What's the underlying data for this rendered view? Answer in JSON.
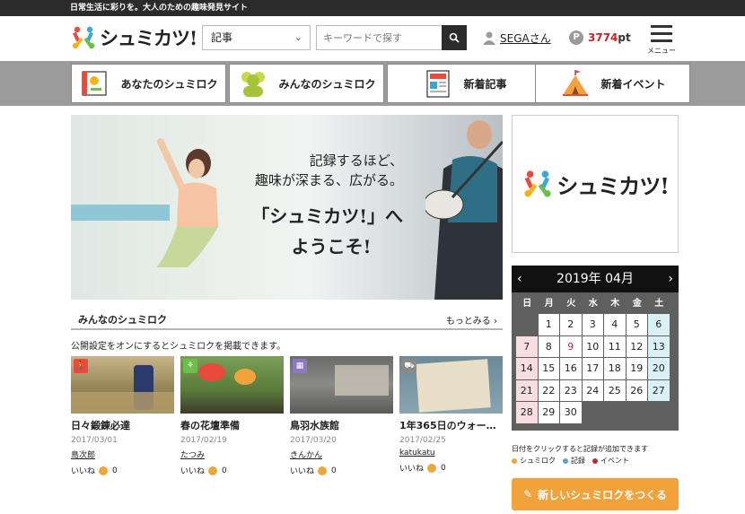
{
  "topbar": {
    "tagline": "日常生活に彩りを。大人のための趣味発見サイト"
  },
  "header": {
    "logo_text": "シュミカツ!",
    "category_select": {
      "value": "記事"
    },
    "search": {
      "placeholder": "キーワードで探す"
    },
    "user": {
      "name": "SEGAさん"
    },
    "points": {
      "value": "3774",
      "unit": "pt"
    },
    "menu_label": "メニュー"
  },
  "nav": {
    "tabs": [
      {
        "label": "あなたのシュミロク"
      },
      {
        "label": "みんなのシュミロク"
      },
      {
        "label": "新着記事"
      },
      {
        "label": "新着イベント"
      }
    ]
  },
  "hero": {
    "line1": "記録するほど、",
    "line2": "趣味が深まる、広がる。",
    "line3": "「シュミカツ!」へ",
    "line4": "ようこそ!"
  },
  "section": {
    "title": "みんなのシュミロク",
    "more": "もっとみる",
    "note": "公開設定をオンにするとシュミロクを掲載できます。"
  },
  "cards": [
    {
      "title": "日々鍛錬必達",
      "date": "2017/03/01",
      "user": "島次郎",
      "like_label": "いいね",
      "likes": "0"
    },
    {
      "title": "春の花壇準備",
      "date": "2017/02/19",
      "user": "たつみ",
      "like_label": "いいね",
      "likes": "0"
    },
    {
      "title": "鳥羽水族館",
      "date": "2017/03/20",
      "user": "きんかん",
      "like_label": "いいね",
      "likes": "0"
    },
    {
      "title": "1年365日のウォー…",
      "date": "2017/02/25",
      "user": "katukatu",
      "like_label": "いいね",
      "likes": "0"
    }
  ],
  "sidebar": {
    "logo_text": "シュミカツ!"
  },
  "calendar": {
    "title": "2019年 04月",
    "weekdays": [
      "日",
      "月",
      "火",
      "水",
      "木",
      "金",
      "土"
    ],
    "days": [
      "1",
      "2",
      "3",
      "4",
      "5",
      "6",
      "7",
      "8",
      "9",
      "10",
      "11",
      "12",
      "13",
      "14",
      "15",
      "16",
      "17",
      "18",
      "19",
      "20",
      "21",
      "22",
      "23",
      "24",
      "25",
      "26",
      "27",
      "28",
      "29",
      "30"
    ],
    "holiday_day": "9",
    "note": "日付をクリックすると記録が追加できます",
    "legend": [
      {
        "label": "シュミロク",
        "color": "#f2a23b"
      },
      {
        "label": "記録",
        "color": "#5aa0c8"
      },
      {
        "label": "イベント",
        "color": "#c2272d"
      }
    ]
  },
  "cta": {
    "label": "新しいシュミロクをつくる"
  },
  "colors": {
    "accent": "#f2a23b",
    "dark": "#2b2b2b",
    "points": "#c2272d"
  }
}
